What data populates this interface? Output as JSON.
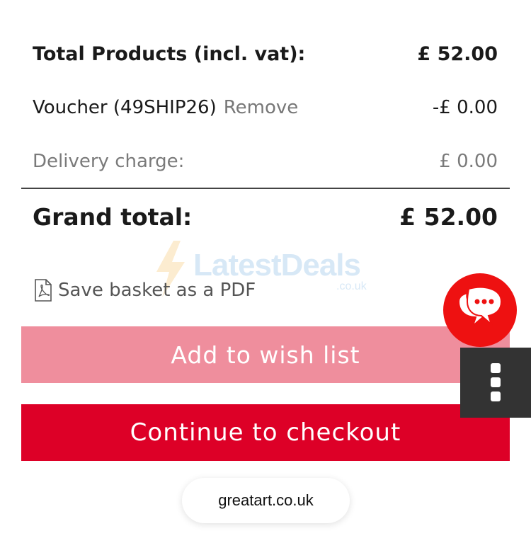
{
  "summary": {
    "total_products_label": "Total Products (incl. vat):",
    "total_products_value": "£ 52.00",
    "voucher_label": "Voucher (49SHIP26)",
    "voucher_remove": "Remove",
    "voucher_value": "-£ 0.00",
    "delivery_label": "Delivery charge:",
    "delivery_value": "£ 0.00",
    "grand_total_label": "Grand total:",
    "grand_total_value": "£ 52.00"
  },
  "watermark": {
    "brand": "LatestDeals",
    "domain": ".co.uk",
    "icon": "lightning-bolt-icon"
  },
  "actions": {
    "save_pdf_label": "Save basket as a PDF",
    "save_pdf_icon": "pdf-file-icon",
    "wishlist_label": "Add to wish list",
    "checkout_label": "Continue to checkout"
  },
  "widgets": {
    "chat_icon": "chat-bubbles-icon",
    "menu_icon": "vertical-dots-icon"
  },
  "browser": {
    "url": "greatart.co.uk"
  },
  "colors": {
    "checkout": "#dd0027",
    "wishlist": "#ef8e9d",
    "chat": "#ee1111",
    "menu_tab": "#333333"
  }
}
